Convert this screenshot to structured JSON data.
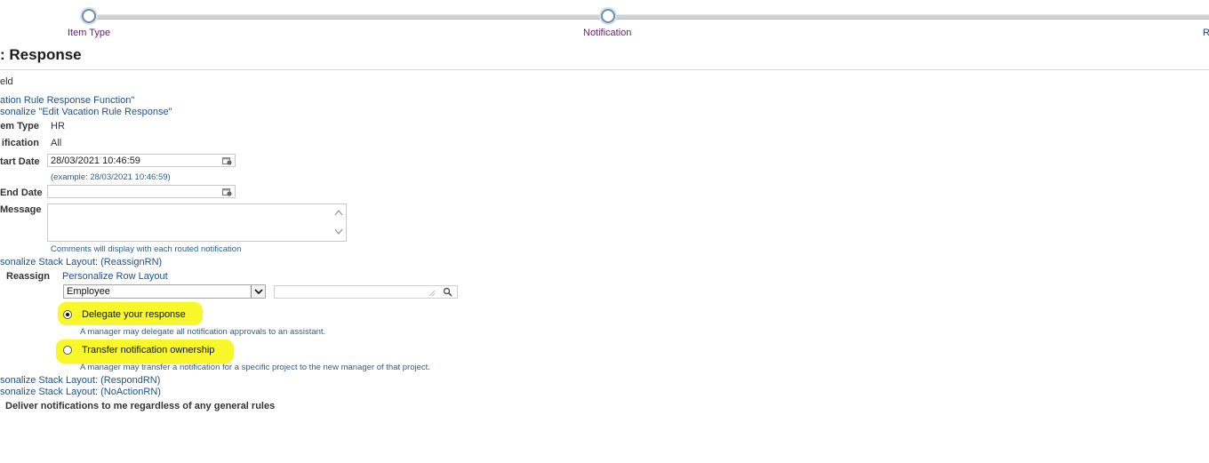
{
  "train": {
    "steps": [
      {
        "label": "Item Type"
      },
      {
        "label": "Notification"
      },
      {
        "label": "R"
      }
    ]
  },
  "page": {
    "title": ": Response",
    "required_note": "eld"
  },
  "links": {
    "response_function": "ation Rule Response Function\"",
    "personalize_edit": "sonalize \"Edit Vacation Rule Response\"",
    "stack_reassign": "sonalize Stack Layout: (ReassignRN)",
    "row_layout": "Personalize Row Layout",
    "stack_respond": "sonalize Stack Layout: (RespondRN)",
    "stack_noaction": "sonalize Stack Layout: (NoActionRN)"
  },
  "fields": {
    "item_type": {
      "label": "em Type",
      "value": "HR"
    },
    "notification": {
      "label": "ification",
      "value": "All"
    },
    "start_date": {
      "label": "tart Date",
      "value": "28/03/2021 10:46:59",
      "hint": "(example: 28/03/2021 10:46:59)"
    },
    "end_date": {
      "label": "End Date",
      "value": ""
    },
    "message": {
      "label": "Message",
      "value": "",
      "hint": "Comments will display with each routed notification"
    },
    "reassign": {
      "label": "Reassign",
      "select_value": "Employee",
      "lov_value": ""
    }
  },
  "options": {
    "delegate": {
      "label": "Delegate your response",
      "desc": "A manager may delegate all notification approvals to an assistant.",
      "checked": true
    },
    "transfer": {
      "label": "Transfer notification ownership",
      "desc": "A manager may transfer a notification for a specific project to the new manager of that project.",
      "checked": false
    }
  },
  "footer": {
    "deliver": "Deliver notifications to me regardless of any general rules"
  },
  "colors": {
    "highlight": "#f7f72a",
    "link": "#1f4f8f",
    "train_label": "#6b1a6f"
  }
}
